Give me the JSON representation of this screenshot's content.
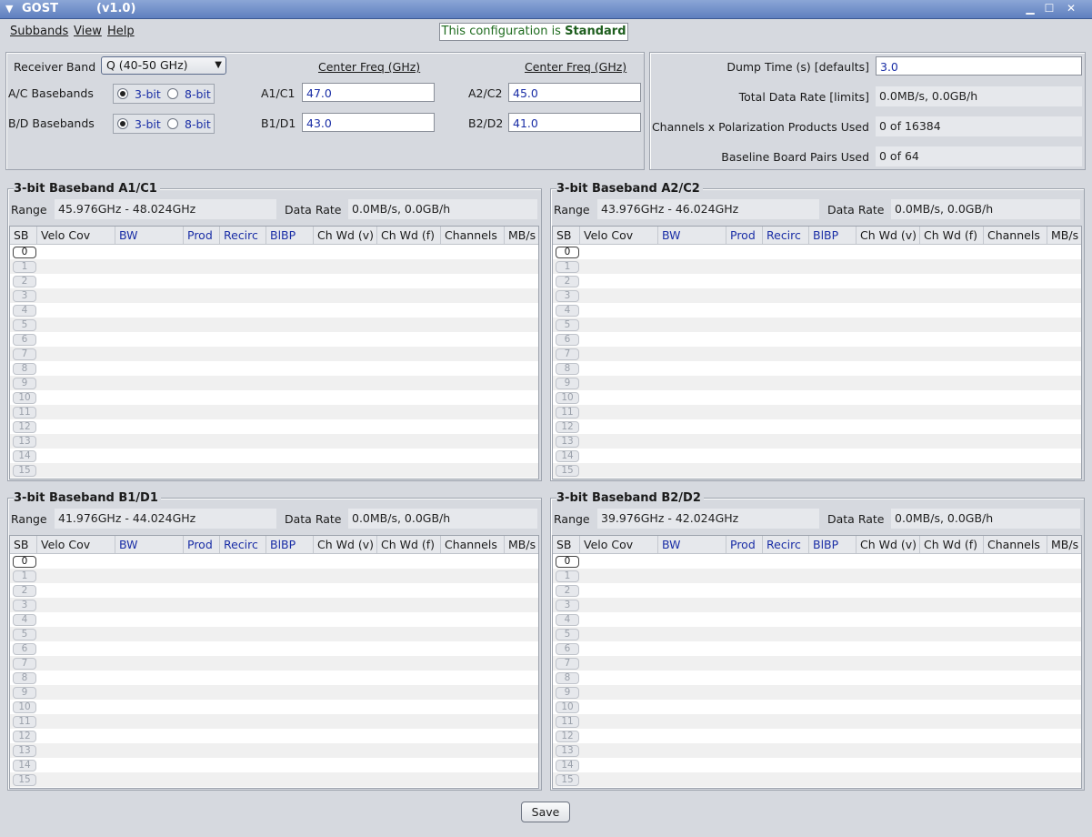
{
  "window": {
    "title": "GOST",
    "version": "(v1.0)",
    "menu_icon": "triangle-down-icon",
    "controls": [
      "minimize-icon",
      "maximize-icon",
      "close-icon"
    ]
  },
  "menu": {
    "subbands": "Subbands",
    "view": "View",
    "help": "Help"
  },
  "status": {
    "prefix": "This configuration is",
    "value": "Standard"
  },
  "receiver": {
    "band_label": "Receiver Band",
    "band_value": "Q (40-50 GHz)",
    "center_freq_header_1": "Center Freq (GHz)",
    "center_freq_header_2": "Center Freq (GHz)",
    "ac_label": "A/C Basebands",
    "bd_label": "B/D Basebands",
    "opt_3bit": "3-bit",
    "opt_8bit": "8-bit",
    "ac_selected": "3-bit",
    "bd_selected": "3-bit",
    "a1c1_label": "A1/C1",
    "a1c1_value": "47.0",
    "a2c2_label": "A2/C2",
    "a2c2_value": "45.0",
    "b1d1_label": "B1/D1",
    "b1d1_value": "43.0",
    "b2d2_label": "B2/D2",
    "b2d2_value": "41.0"
  },
  "summary": {
    "dump_time_label": "Dump Time (s) [defaults]",
    "dump_time_value": "3.0",
    "total_rate_label": "Total Data Rate [limits]",
    "total_rate_value": "0.0MB/s, 0.0GB/h",
    "channels_label": "Channels x Polarization Products Used",
    "channels_value": "0 of 16384",
    "baseline_label": "Baseline Board Pairs Used",
    "baseline_value": "0 of 64"
  },
  "columns": [
    "SB",
    "Velo Cov",
    "BW",
    "Prod",
    "Recirc",
    "BlBP",
    "Ch Wd (v)",
    "Ch Wd (f)",
    "Channels",
    "MB/s"
  ],
  "sb_numbers": [
    "0",
    "1",
    "2",
    "3",
    "4",
    "5",
    "6",
    "7",
    "8",
    "9",
    "10",
    "11",
    "12",
    "13",
    "14",
    "15"
  ],
  "basebands": [
    {
      "title": "3-bit Baseband A1/C1",
      "range_label": "Range",
      "range": "45.976GHz - 48.024GHz",
      "rate_label": "Data Rate",
      "rate": "0.0MB/s, 0.0GB/h"
    },
    {
      "title": "3-bit Baseband A2/C2",
      "range_label": "Range",
      "range": "43.976GHz - 46.024GHz",
      "rate_label": "Data Rate",
      "rate": "0.0MB/s, 0.0GB/h"
    },
    {
      "title": "3-bit Baseband B1/D1",
      "range_label": "Range",
      "range": "41.976GHz - 44.024GHz",
      "rate_label": "Data Rate",
      "rate": "0.0MB/s, 0.0GB/h"
    },
    {
      "title": "3-bit Baseband B2/D2",
      "range_label": "Range",
      "range": "39.976GHz - 42.024GHz",
      "rate_label": "Data Rate",
      "rate": "0.0MB/s, 0.0GB/h"
    }
  ],
  "save_label": "Save"
}
